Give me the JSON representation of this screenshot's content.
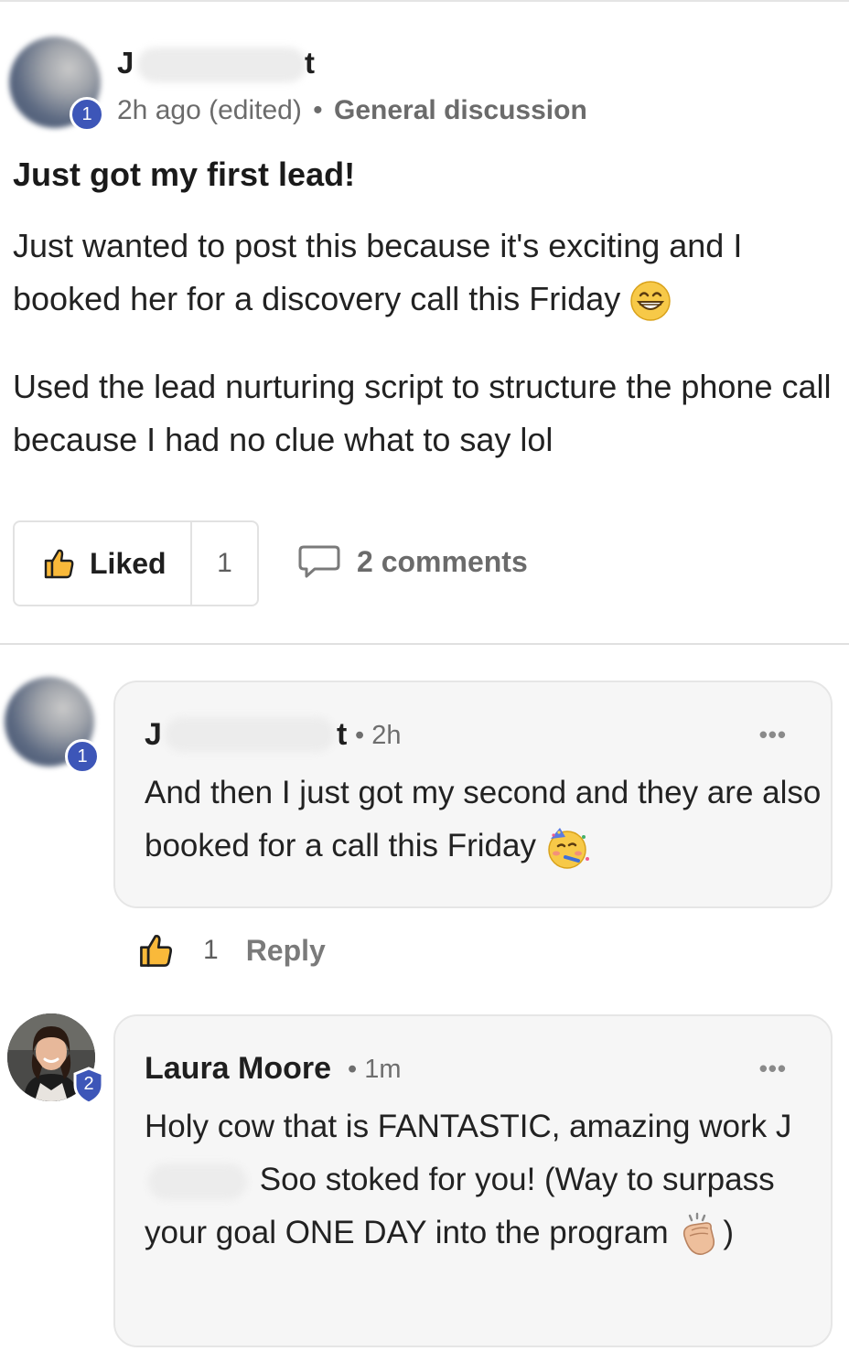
{
  "post": {
    "author_first": "J",
    "author_last": "t",
    "author_level": "1",
    "time": "2h ago (edited)",
    "separator": "•",
    "category": "General discussion",
    "title": "Just got my first lead!",
    "paragraph1": "Just wanted to post this because it's exciting and I booked her for a discovery call this Friday",
    "paragraph2": "Used the lead nurturing script to structure the phone call because I had no clue what to say lol",
    "like_label": "Liked",
    "like_count": "1",
    "comments_label": "2 comments"
  },
  "comments": [
    {
      "author_first": "J",
      "author_last": "t",
      "level": "1",
      "time": "2h",
      "separator": "•",
      "menu": "•••",
      "text": "And then I just got my second and they are also booked for a call this Friday",
      "like_count": "1",
      "reply_label": "Reply"
    },
    {
      "author": "Laura Moore",
      "level": "2",
      "time": "1m",
      "separator": "•",
      "menu": "•••",
      "text_before": "Holy cow that is FANTASTIC, amazing work",
      "text_initial": "J",
      "text_after": "Soo stoked for you! (Way to surpass your goal ONE DAY into the program",
      "text_close": ")"
    }
  ],
  "colors": {
    "badge_blue": "#3d56b8",
    "text_dark": "#1f1f1f",
    "text_muted": "#6b6b6b",
    "bubble_bg": "#f6f6f6"
  },
  "icons": [
    "thumbs-up-icon",
    "comment-bubble-icon",
    "more-options-icon",
    "grinning-emoji-icon",
    "partying-face-emoji-icon",
    "clapping-hands-emoji-icon"
  ]
}
